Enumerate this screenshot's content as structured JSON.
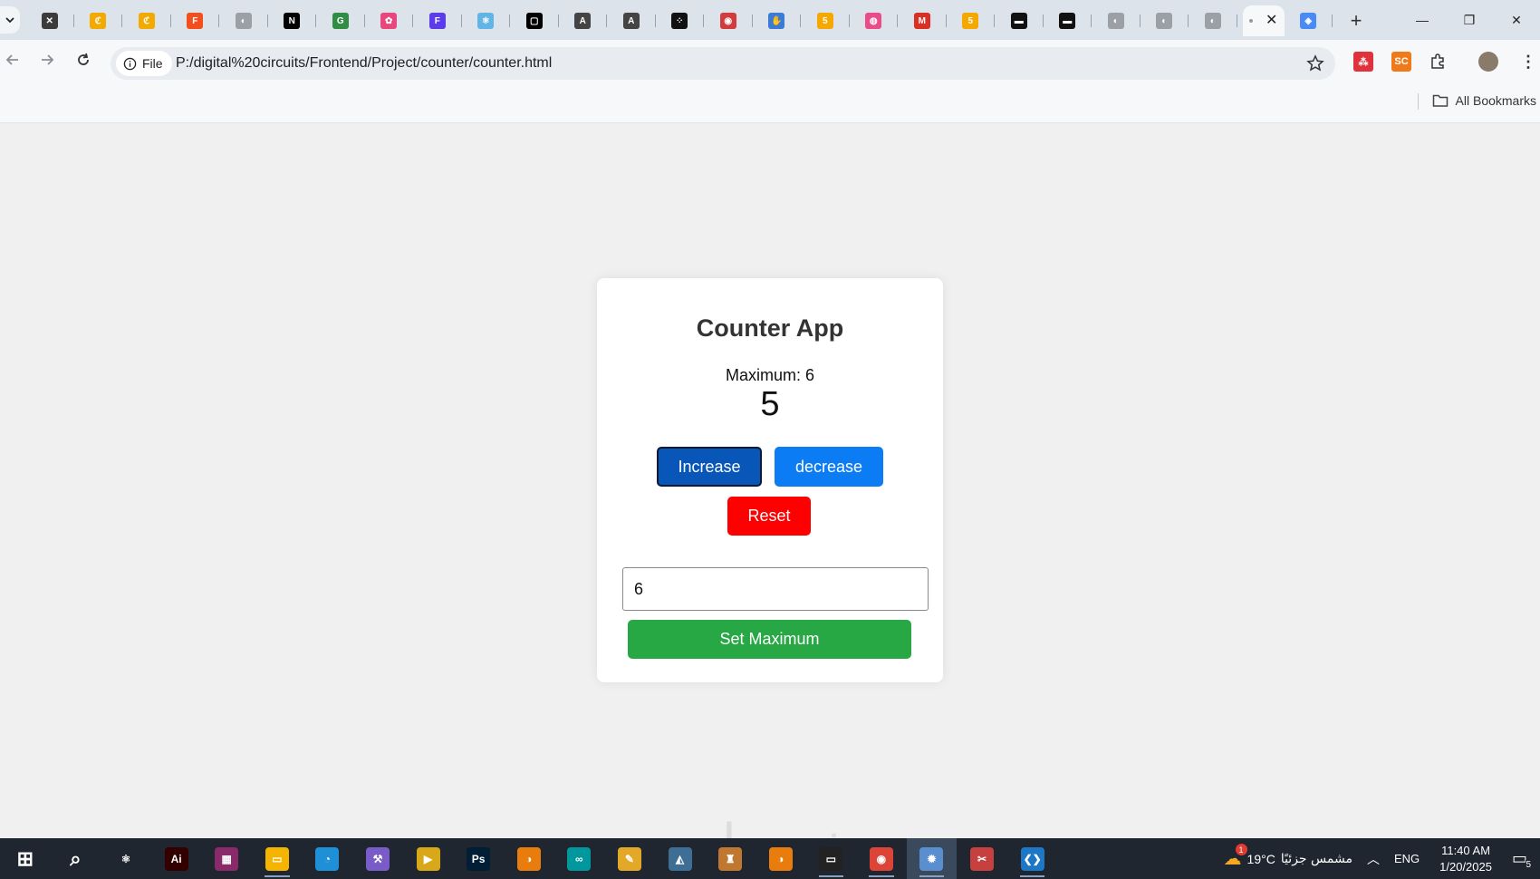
{
  "browser": {
    "tabs": [
      {
        "icon": "tab-favicon-x-icon",
        "glyph": "✕",
        "color": "#3b3b3b"
      },
      {
        "icon": "tab-favicon-codepen-icon",
        "glyph": "ℭ",
        "color": "#f2a900"
      },
      {
        "icon": "tab-favicon-codepen-icon",
        "glyph": "ℭ",
        "color": "#f2a900"
      },
      {
        "icon": "tab-favicon-figma-icon",
        "glyph": "F",
        "color": "#f24e1e"
      },
      {
        "icon": "tab-favicon-globe-icon",
        "glyph": "◐",
        "color": "#9aa0a6"
      },
      {
        "icon": "tab-favicon-next-icon",
        "glyph": "N",
        "color": "#000000"
      },
      {
        "icon": "tab-favicon-geeks-icon",
        "glyph": "G",
        "color": "#2f8d46"
      },
      {
        "icon": "tab-favicon-dots-icon",
        "glyph": "✿",
        "color": "#e8467c"
      },
      {
        "icon": "tab-favicon-framer-icon",
        "glyph": "F",
        "color": "#5b3bea"
      },
      {
        "icon": "tab-favicon-react-icon",
        "glyph": "⚛",
        "color": "#61b4e6"
      },
      {
        "icon": "tab-favicon-square-icon",
        "glyph": "▢",
        "color": "#000000"
      },
      {
        "icon": "tab-favicon-font-icon",
        "glyph": "A",
        "color": "#444444"
      },
      {
        "icon": "tab-favicon-font-icon",
        "glyph": "A",
        "color": "#444444"
      },
      {
        "icon": "tab-favicon-dice-icon",
        "glyph": "⁘",
        "color": "#111111"
      },
      {
        "icon": "tab-favicon-eye-icon",
        "glyph": "◉",
        "color": "#d13c3c"
      },
      {
        "icon": "tab-favicon-hand-icon",
        "glyph": "✋",
        "color": "#3a7bd5"
      },
      {
        "icon": "tab-favicon-five-icon",
        "glyph": "5",
        "color": "#f5a800"
      },
      {
        "icon": "tab-favicon-dribbble-icon",
        "glyph": "◍",
        "color": "#ea4c89"
      },
      {
        "icon": "tab-favicon-gmail-icon",
        "glyph": "M",
        "color": "#d93025"
      },
      {
        "icon": "tab-favicon-five-icon",
        "glyph": "5",
        "color": "#f5a800"
      },
      {
        "icon": "tab-favicon-dark-icon",
        "glyph": "▬",
        "color": "#111111"
      },
      {
        "icon": "tab-favicon-dark-icon",
        "glyph": "▬",
        "color": "#111111"
      },
      {
        "icon": "tab-favicon-globe-icon",
        "glyph": "◐",
        "color": "#9aa0a6"
      },
      {
        "icon": "tab-favicon-globe-icon",
        "glyph": "◐",
        "color": "#9aa0a6"
      },
      {
        "icon": "tab-favicon-globe-icon",
        "glyph": "◐",
        "color": "#9aa0a6"
      }
    ],
    "active_tab_close": "✕",
    "after_tab_icon": {
      "glyph": "◈",
      "color": "#4a8af4"
    },
    "new_tab": "+",
    "window_controls": {
      "minimize": "—",
      "restore": "❐",
      "close": "✕"
    },
    "site_info_label": "File",
    "url": "P:/digital%20circuits/Frontend/Project/counter/counter.html",
    "extensions": [
      {
        "icon": "extension-red-icon",
        "glyph": "⁂",
        "color": "#e0323c"
      },
      {
        "icon": "extension-sc-icon",
        "glyph": "SC",
        "color": "#f07a1a"
      },
      {
        "icon": "extension-puzzle-icon",
        "glyph": "",
        "color": "transparent"
      }
    ],
    "bookmarks_label": "All Bookmarks"
  },
  "app": {
    "title": "Counter App",
    "max_prefix": "Maximum: ",
    "max_value": "6",
    "count": "5",
    "increase_label": "Increase",
    "decrease_label": "decrease",
    "reset_label": "Reset",
    "max_input_value": "6",
    "set_max_label": "Set Maximum",
    "colors": {
      "increase": "#0756b8",
      "decrease": "#0b7cf4",
      "reset": "#ff0000",
      "set_max": "#27a844"
    }
  },
  "taskbar": {
    "apps": [
      {
        "name": "start",
        "glyph": "⊞",
        "color": "transparent"
      },
      {
        "name": "search",
        "glyph": "⌕",
        "color": "transparent"
      },
      {
        "name": "atom",
        "glyph": "⚛",
        "color": "transparent"
      },
      {
        "name": "illustrator",
        "glyph": "Ai",
        "color": "#330000"
      },
      {
        "name": "winrar",
        "glyph": "▦",
        "color": "#8b2a6b"
      },
      {
        "name": "file-explorer",
        "glyph": "▭",
        "color": "#f4b400"
      },
      {
        "name": "edge",
        "glyph": "◔",
        "color": "#1f8fd8"
      },
      {
        "name": "tool",
        "glyph": "⚒",
        "color": "#7a5cc8"
      },
      {
        "name": "media",
        "glyph": "▶",
        "color": "#d8a81a"
      },
      {
        "name": "photoshop",
        "glyph": "Ps",
        "color": "#001e36"
      },
      {
        "name": "blender",
        "glyph": "◑",
        "color": "#e87d0d"
      },
      {
        "name": "arduino",
        "glyph": "∞",
        "color": "#00979d"
      },
      {
        "name": "sticky",
        "glyph": "✎",
        "color": "#e4a829"
      },
      {
        "name": "mysql",
        "glyph": "◭",
        "color": "#3e6e93"
      },
      {
        "name": "rocket",
        "glyph": "♜",
        "color": "#c07830"
      },
      {
        "name": "blender-2",
        "glyph": "◑",
        "color": "#e87d0d"
      },
      {
        "name": "terminal",
        "glyph": "▭",
        "color": "#222222"
      },
      {
        "name": "chrome",
        "glyph": "◉",
        "color": "#db4437"
      },
      {
        "name": "paint",
        "glyph": "✹",
        "color": "#5a8fcf"
      },
      {
        "name": "git",
        "glyph": "✂",
        "color": "#c74040"
      },
      {
        "name": "vscode",
        "glyph": "❮❯",
        "color": "#1c77c7"
      }
    ],
    "weather_temp": "19°C",
    "weather_text": "مشمس جزئيًا",
    "weather_badge": "1",
    "language": "ENG",
    "time": "11:40 AM",
    "date": "1/20/2025",
    "notifications": "5"
  }
}
